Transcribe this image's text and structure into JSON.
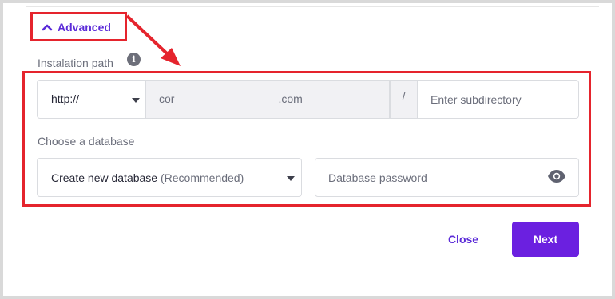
{
  "advanced": {
    "label": "Advanced",
    "icon": "chevron-up-icon"
  },
  "installation_path": {
    "label": "Instalation path",
    "info_icon": "i",
    "protocol": {
      "value": "http://"
    },
    "domain": {
      "value_start": "cor",
      "value_end": ".com"
    },
    "separator": "/",
    "subdirectory": {
      "placeholder": "Enter subdirectory",
      "value": ""
    }
  },
  "database": {
    "label": "Choose a database",
    "select": {
      "value": "Create new database",
      "hint": "(Recommended)"
    },
    "password": {
      "placeholder": "Database password",
      "value": ""
    }
  },
  "actions": {
    "close_label": "Close",
    "next_label": "Next"
  },
  "colors": {
    "accent": "#6b20e0",
    "annotation_red": "#e5242d"
  }
}
